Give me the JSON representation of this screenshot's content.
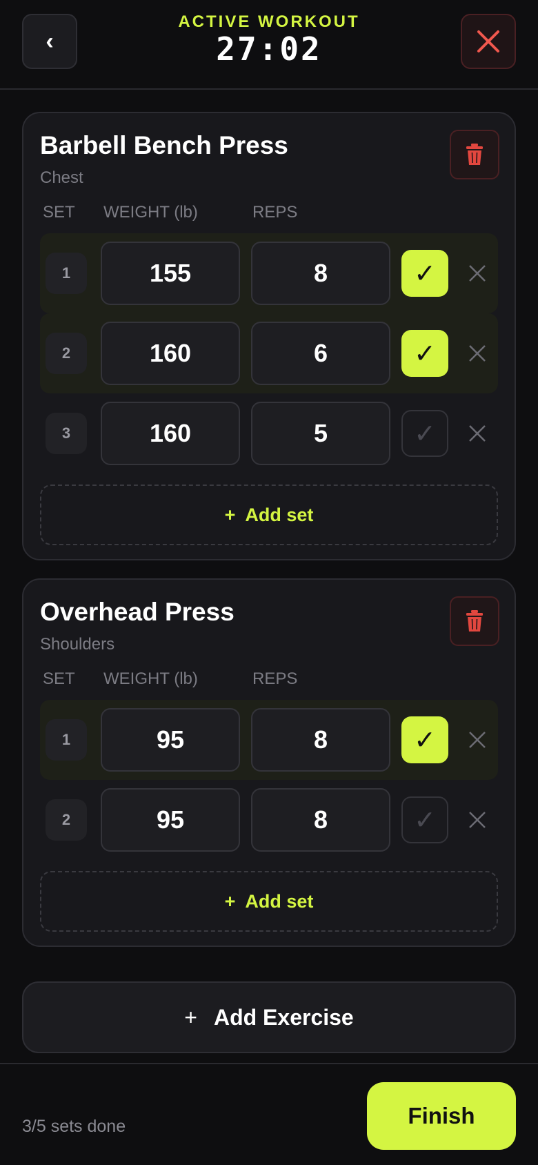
{
  "header": {
    "eyebrow": "ACTIVE WORKOUT",
    "timer": "27:02",
    "back_icon": "‹"
  },
  "columns": {
    "set": "SET",
    "weight": "WEIGHT (lb)",
    "reps": "REPS"
  },
  "exercises": [
    {
      "name": "Barbell Bench Press",
      "muscle": "Chest",
      "sets": [
        {
          "num": "1",
          "weight": "155",
          "reps": "8",
          "done": true
        },
        {
          "num": "2",
          "weight": "160",
          "reps": "6",
          "done": true
        },
        {
          "num": "3",
          "weight": "160",
          "reps": "5",
          "done": false
        }
      ],
      "add_set_label": "Add set"
    },
    {
      "name": "Overhead Press",
      "muscle": "Shoulders",
      "sets": [
        {
          "num": "1",
          "weight": "95",
          "reps": "8",
          "done": true
        },
        {
          "num": "2",
          "weight": "95",
          "reps": "8",
          "done": false
        }
      ],
      "add_set_label": "Add set"
    }
  ],
  "add_exercise_label": "Add Exercise",
  "footer": {
    "progress": "3/5 sets done",
    "finish_label": "Finish"
  },
  "glyphs": {
    "check": "✓",
    "plus": "+"
  },
  "colors": {
    "accent": "#d4f542",
    "danger": "#f0584e",
    "background": "#0e0e10",
    "card": "#18181c"
  }
}
